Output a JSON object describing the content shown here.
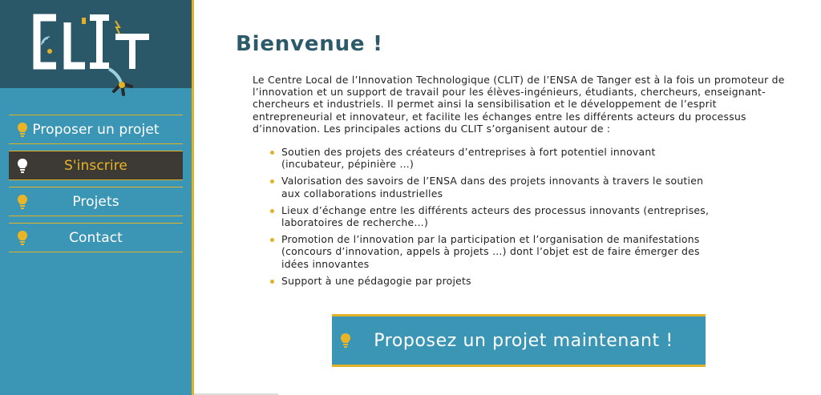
{
  "brand": {
    "logo_text": "CLIT",
    "colors": {
      "sidebar": "#3b96b5",
      "logo_bg": "#2b5868",
      "accent": "#e2b125",
      "active_bg": "#3d3a36",
      "title": "#2c5a6b"
    }
  },
  "sidebar": {
    "items": [
      {
        "label": "Proposer un projet",
        "icon": "lightbulb-icon",
        "active": false
      },
      {
        "label": "S'inscrire",
        "icon": "lightbulb-icon",
        "active": true
      },
      {
        "label": "Projets",
        "icon": "lightbulb-icon",
        "active": false
      },
      {
        "label": "Contact",
        "icon": "lightbulb-icon",
        "active": false
      }
    ]
  },
  "main": {
    "title": "Bienvenue !",
    "intro": "Le Centre Local de l’Innovation Technologique (CLIT) de l’ENSA de Tanger est à la fois un promoteur de l’innovation et un support de travail pour les élèves-ingénieurs, étudiants, chercheurs, enseignant-chercheurs et industriels. Il permet ainsi la sensibilisation et le développement de l’esprit entrepreneurial et innovateur, et facilite les échanges entre les différents acteurs du processus d’innovation. Les principales actions du CLIT s’organisent autour de :",
    "features": [
      "Soutien des projets des créateurs d’entreprises à fort potentiel innovant (incubateur, pépinière …)",
      "Valorisation des savoirs de l’ENSA dans des projets innovants à travers le soutien aux collaborations industrielles",
      "Lieux d’échange entre les différents acteurs des processus innovants (entreprises, laboratoires de recherche…)",
      "Promotion de l’innovation par la participation et l’organisation de manifestations (concours d’innovation, appels à projets …) dont l’objet est de faire émerger des idées innovantes",
      "Support à une pédagogie par projets"
    ],
    "cta_label": "Proposez un projet maintenant !",
    "cta_icon": "lightbulb-icon"
  }
}
